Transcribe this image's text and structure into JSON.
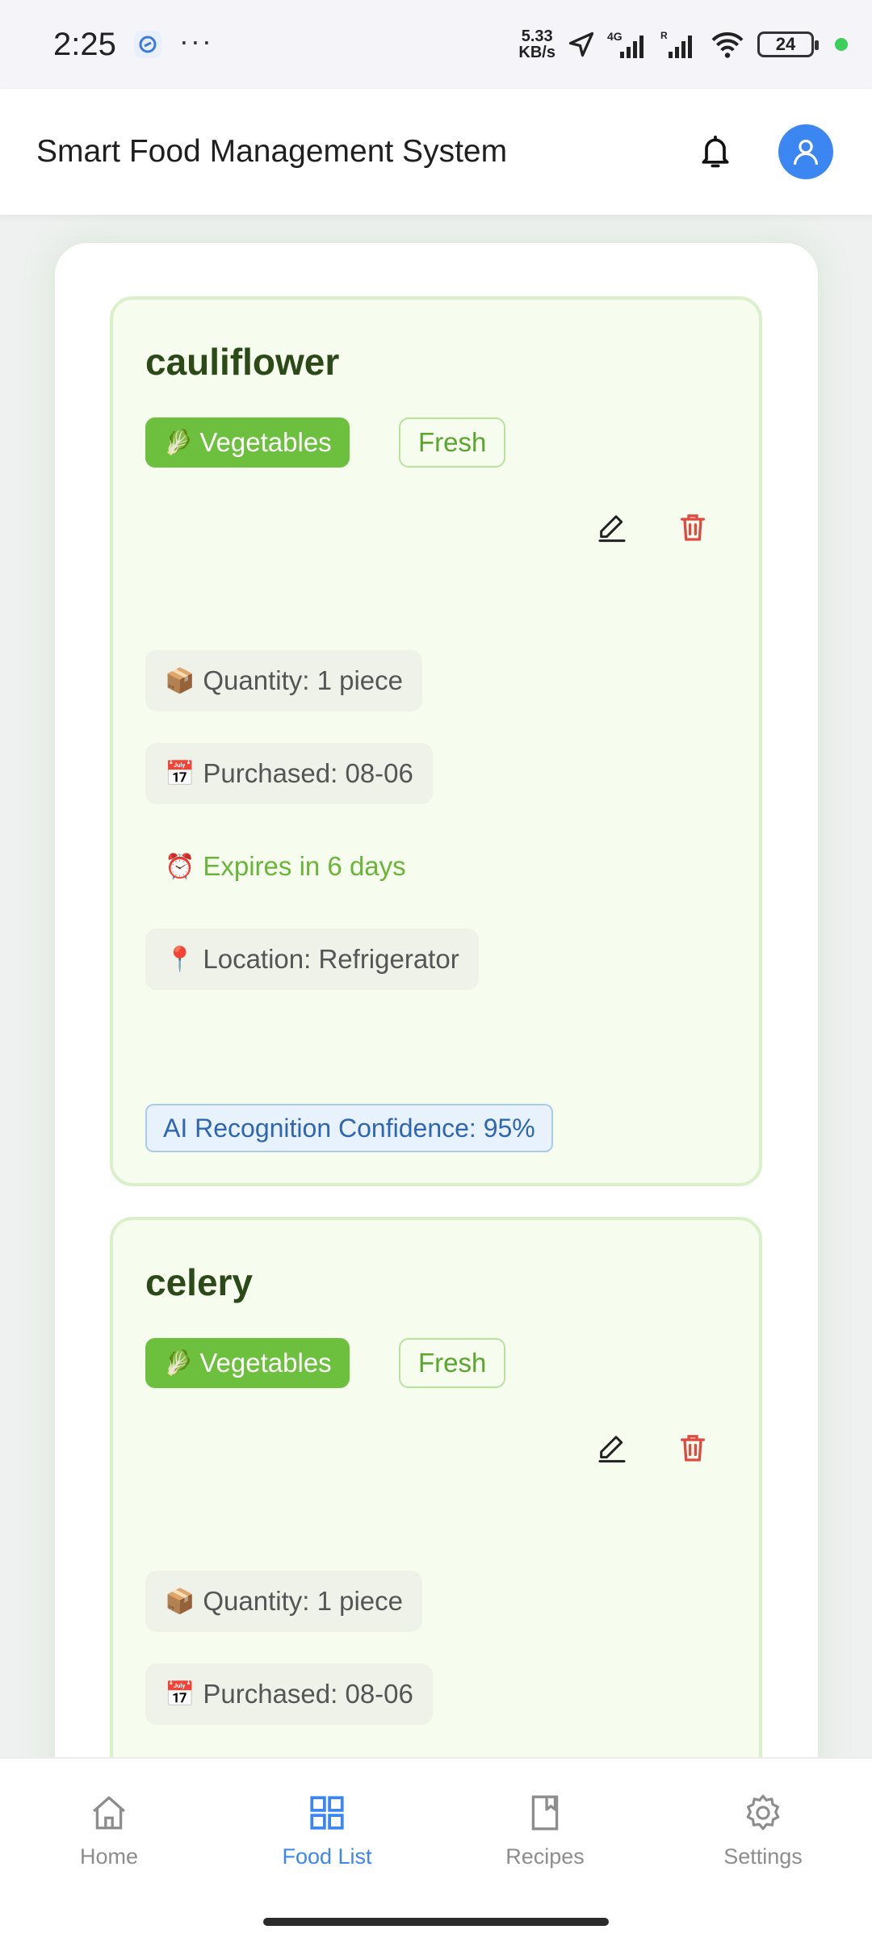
{
  "status_bar": {
    "time": "2:25",
    "more": "···",
    "net_speed_value": "5.33",
    "net_speed_unit": "KB/s",
    "network": "4G",
    "roaming": "R",
    "battery": "24"
  },
  "header": {
    "title": "Smart Food Management System"
  },
  "foods": [
    {
      "name": "cauliflower",
      "category_icon": "🥬",
      "category": "Vegetables",
      "status": "Fresh",
      "quantity_icon": "📦",
      "quantity": "Quantity: 1 piece",
      "purchased_icon": "📅",
      "purchased": "Purchased: 08-06",
      "expiry_icon": "⏰",
      "expiry": "Expires in 6 days",
      "location_icon": "📍",
      "location": "Location: Refrigerator",
      "ai_confidence": "AI Recognition Confidence: 95%"
    },
    {
      "name": "celery",
      "category_icon": "🥬",
      "category": "Vegetables",
      "status": "Fresh",
      "quantity_icon": "📦",
      "quantity": "Quantity: 1 piece",
      "purchased_icon": "📅",
      "purchased": "Purchased: 08-06"
    }
  ],
  "nav": {
    "items": [
      {
        "label": "Home",
        "icon": "home-icon"
      },
      {
        "label": "Food List",
        "icon": "grid-icon"
      },
      {
        "label": "Recipes",
        "icon": "book-icon"
      },
      {
        "label": "Settings",
        "icon": "gear-icon"
      }
    ],
    "active": "Food List"
  },
  "colors": {
    "accent_blue": "#3b86f0",
    "category_green": "#6cc03e",
    "delete_red": "#e04a3f",
    "card_bg": "#f6fdef"
  }
}
